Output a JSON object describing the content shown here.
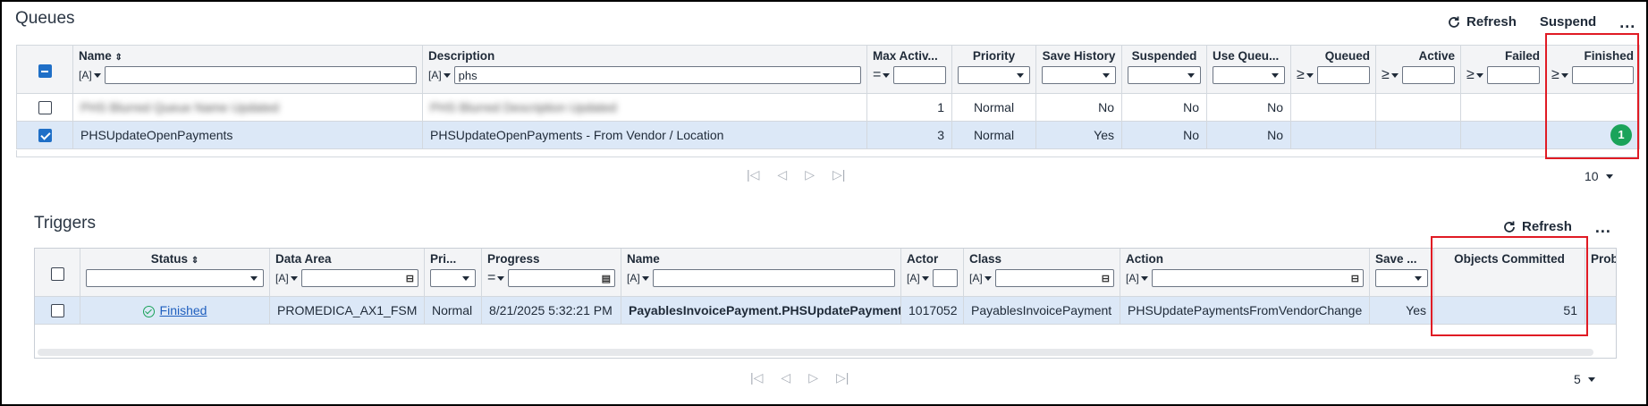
{
  "queues": {
    "title": "Queues",
    "toolbar": {
      "refresh_label": "Refresh",
      "suspend_label": "Suspend",
      "more_label": "..."
    },
    "columns": {
      "name": "Name",
      "description": "Description",
      "max_active": "Max Activ...",
      "priority": "Priority",
      "save_history": "Save History",
      "suspended": "Suspended",
      "use_queue": "Use Queu...",
      "queued": "Queued",
      "active": "Active",
      "failed": "Failed",
      "finished": "Finished"
    },
    "filters": {
      "text_type": "[A]",
      "desc_value": "phs",
      "num_op": "=",
      "ge_op": "≥"
    },
    "rows": [
      {
        "name": "PHS Blurred Queue Name Updated",
        "description": "PHS Blurred Description Updated",
        "max_active": "1",
        "priority": "Normal",
        "save_history": "No",
        "suspended": "No",
        "use_queue": "No",
        "queued": "",
        "active": "",
        "failed": "",
        "finished": ""
      },
      {
        "name": "PHSUpdateOpenPayments",
        "description": "PHSUpdateOpenPayments - From Vendor / Location",
        "max_active": "3",
        "priority": "Normal",
        "save_history": "Yes",
        "suspended": "No",
        "use_queue": "No",
        "queued": "",
        "active": "",
        "failed": "",
        "finished": "1"
      }
    ],
    "pager": {
      "first": "|◁",
      "prev": "◁",
      "next": "▷",
      "last": "▷|",
      "page_size": "10"
    }
  },
  "triggers": {
    "title": "Triggers",
    "toolbar": {
      "refresh_label": "Refresh",
      "more_label": "..."
    },
    "columns": {
      "status": "Status",
      "data_area": "Data Area",
      "priority": "Pri...",
      "progress": "Progress",
      "name": "Name",
      "actor": "Actor",
      "class": "Class",
      "action": "Action",
      "save": "Save ...",
      "objects_committed": "Objects Committed",
      "problems": "Probl"
    },
    "filters": {
      "text_type": "[A]",
      "num_op": "="
    },
    "rows": [
      {
        "status": "Finished",
        "data_area": "PROMEDICA_AX1_FSM",
        "priority": "Normal",
        "progress": "8/21/2025 5:32:21 PM",
        "name": "PayablesInvoicePayment.PHSUpdatePayments",
        "actor": "1017052",
        "class": "PayablesInvoicePayment",
        "action": "PHSUpdatePaymentsFromVendorChange",
        "save": "Yes",
        "objects_committed": "51",
        "problems": ""
      }
    ],
    "pager": {
      "first": "|◁",
      "prev": "◁",
      "next": "▷",
      "last": "▷|",
      "page_size": "5"
    }
  },
  "colors": {
    "accent": "#1f6fc7",
    "selected_row": "#dce8f7",
    "badge_green": "#1aa35a",
    "highlight_red": "#e01b24"
  }
}
